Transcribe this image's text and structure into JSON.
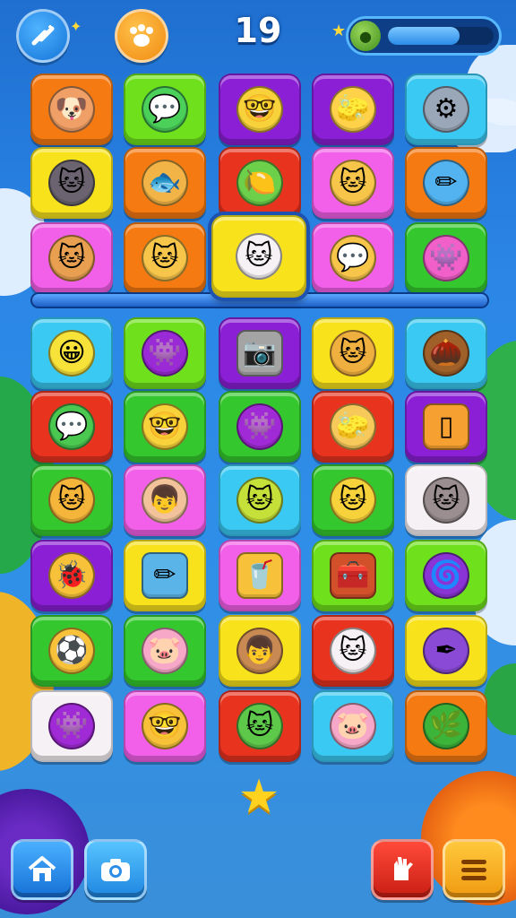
{
  "hud": {
    "score": "19",
    "left_button_icon": "wand-icon",
    "right_button_icon": "paw-icon",
    "progress_fraction": 0.68,
    "progress_orb_icon": "fruit-icon"
  },
  "colors": {
    "red": "#e8331f",
    "lime": "#6fe01c",
    "purple": "#8b1fd6",
    "cyan": "#39c9f2",
    "yellow": "#f7e21b",
    "orange": "#f57a12",
    "pink": "#f25fe8",
    "green": "#34c82e",
    "white": "#f6f1f4",
    "skin": "#f4b45c"
  },
  "grid": {
    "rows": [
      [
        {
          "color": "orange",
          "icon": "dog-face-icon",
          "glyph": "🐶",
          "face": "#f0a066"
        },
        {
          "color": "lime",
          "icon": "chat-bubble-face-icon",
          "glyph": "💬",
          "face": "#4bd05a"
        },
        {
          "color": "purple",
          "icon": "nerd-face-icon",
          "glyph": "🤓",
          "face": "#f7d23a"
        },
        {
          "color": "purple",
          "icon": "eraser-icon",
          "glyph": "🧽",
          "face": "#ffd24a"
        },
        {
          "color": "cyan",
          "icon": "robot-badge-icon",
          "glyph": "⚙",
          "face": "#9aa7b8"
        }
      ],
      [
        {
          "color": "yellow",
          "icon": "black-cat-icon",
          "glyph": "🐱",
          "face": "#6b6470"
        },
        {
          "color": "orange",
          "icon": "fish-icon",
          "glyph": "🐟",
          "face": "#f2b446"
        },
        {
          "color": "red",
          "icon": "lime-icon",
          "glyph": "🍋",
          "face": "#6cd04a"
        },
        {
          "color": "pink",
          "icon": "cat-face-icon",
          "glyph": "🐱",
          "face": "#f7c54a"
        },
        {
          "color": "orange",
          "icon": "pencil-icon",
          "glyph": "✏",
          "face": "#52b3f0"
        }
      ],
      [
        {
          "color": "pink",
          "icon": "cat-face-icon",
          "glyph": "🐱",
          "face": "#e8a050"
        },
        {
          "color": "orange",
          "icon": "cat-face-icon",
          "glyph": "🐱",
          "face": "#f7c54a"
        },
        {
          "color": "yellow",
          "icon": "white-cat-icon",
          "glyph": "🐱",
          "face": "#f6f1f4",
          "selected": true
        },
        {
          "color": "pink",
          "icon": "speech-face-icon",
          "glyph": "💬",
          "face": "#f7c54a"
        },
        {
          "color": "green",
          "icon": "pink-blob-icon",
          "glyph": "👾",
          "face": "#f060c8"
        }
      ],
      [
        {
          "color": "cyan",
          "icon": "smiley-face-icon",
          "glyph": "😀",
          "face": "#f7e23a"
        },
        {
          "color": "lime",
          "icon": "purple-blob-icon",
          "glyph": "👾",
          "face": "#9a2ad6"
        },
        {
          "color": "purple",
          "icon": "camera-box-icon",
          "glyph": "📷",
          "face": "#a4a4a4",
          "box": true
        },
        {
          "color": "yellow",
          "icon": "cat-face-icon",
          "glyph": "🐱",
          "face": "#f0b040"
        },
        {
          "color": "cyan",
          "icon": "acorn-icon",
          "glyph": "🌰",
          "face": "#a0602a"
        }
      ],
      [
        {
          "color": "red",
          "icon": "green-chat-icon",
          "glyph": "💬",
          "face": "#4bc850"
        },
        {
          "color": "green",
          "icon": "glasses-face-icon",
          "glyph": "🤓",
          "face": "#f7d23a"
        },
        {
          "color": "green",
          "icon": "purple-blob-icon",
          "glyph": "👾",
          "face": "#a02ad6"
        },
        {
          "color": "red",
          "icon": "eraser-icon",
          "glyph": "🧽",
          "face": "#f7c85a"
        },
        {
          "color": "purple",
          "icon": "mirror-icon",
          "glyph": "▯",
          "face": "#f5a030",
          "box": true
        }
      ],
      [
        {
          "color": "green",
          "icon": "cat-face-icon",
          "glyph": "🐱",
          "face": "#f5b43a"
        },
        {
          "color": "pink",
          "icon": "kid-face-icon",
          "glyph": "👦",
          "face": "#f2c29a"
        },
        {
          "color": "cyan",
          "icon": "cat-face-icon",
          "glyph": "🐱",
          "face": "#c6e03a"
        },
        {
          "color": "green",
          "icon": "cat-face-icon",
          "glyph": "🐱",
          "face": "#f7d23a"
        },
        {
          "color": "white",
          "icon": "gray-cat-icon",
          "glyph": "🐱",
          "face": "#9a8e90"
        }
      ],
      [
        {
          "color": "purple",
          "icon": "bug-icon",
          "glyph": "🐞",
          "face": "#f7c23a"
        },
        {
          "color": "yellow",
          "icon": "paper-pencil-icon",
          "glyph": "✏",
          "face": "#5ab4e8",
          "box": true
        },
        {
          "color": "pink",
          "icon": "pencil-cup-icon",
          "glyph": "🥤",
          "face": "#f7c23a",
          "box": true
        },
        {
          "color": "lime",
          "icon": "treasure-box-icon",
          "glyph": "🧰",
          "face": "#d2502a",
          "box": true
        },
        {
          "color": "lime",
          "icon": "swirl-icon",
          "glyph": "🌀",
          "face": "#8a34d6"
        }
      ],
      [
        {
          "color": "green",
          "icon": "striped-ball-icon",
          "glyph": "⚽",
          "face": "#f7c23a"
        },
        {
          "color": "green",
          "icon": "pig-face-icon",
          "glyph": "🐷",
          "face": "#f7a8c8"
        },
        {
          "color": "yellow",
          "icon": "kid-face-icon",
          "glyph": "👦",
          "face": "#c88a52"
        },
        {
          "color": "red",
          "icon": "white-cat-icon",
          "glyph": "🐱",
          "face": "#f6f1f4"
        },
        {
          "color": "yellow",
          "icon": "pen-circle-icon",
          "glyph": "✒",
          "face": "#8a4ad6"
        }
      ],
      [
        {
          "color": "white",
          "icon": "purple-blob-icon",
          "glyph": "👾",
          "face": "#a02ad6"
        },
        {
          "color": "pink",
          "icon": "glasses-face-icon",
          "glyph": "🤓",
          "face": "#f7c23a"
        },
        {
          "color": "red",
          "icon": "green-cat-icon",
          "glyph": "🐱",
          "face": "#5ec84a"
        },
        {
          "color": "cyan",
          "icon": "pig-face-icon",
          "glyph": "🐷",
          "face": "#f7a8c8"
        },
        {
          "color": "orange",
          "icon": "leaf-icon",
          "glyph": "🌿",
          "face": "#3cb43a"
        }
      ]
    ]
  },
  "footer": {
    "home_icon": "home-icon",
    "camera_icon": "camera-icon",
    "hint_icon": "glove-icon",
    "menu_icon": "menu-icon",
    "star_icon": "star-icon"
  }
}
